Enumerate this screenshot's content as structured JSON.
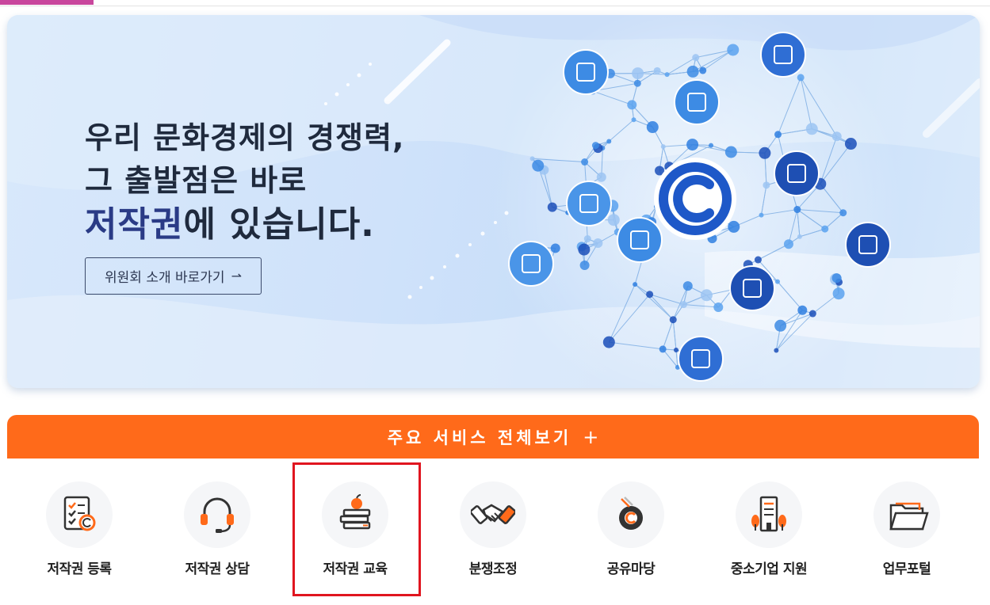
{
  "hero": {
    "line1": "우리 문화경제의 경쟁력,",
    "line2": "그 출발점은 바로",
    "line3_highlight": "저작권",
    "line3_rest": "에 있습니다.",
    "intro_button": "위원회 소개 바로가기",
    "intro_arrow": "⇀"
  },
  "services": {
    "bar_label": "주요 서비스 전체보기",
    "bar_plus": "+",
    "items": [
      {
        "label": "저작권 등록",
        "icon": "registration-checklist-icon"
      },
      {
        "label": "저작권 상담",
        "icon": "headset-icon"
      },
      {
        "label": "저작권 교육",
        "icon": "books-apple-icon"
      },
      {
        "label": "분쟁조정",
        "icon": "handshake-icon"
      },
      {
        "label": "공유마당",
        "icon": "copyright-share-icon"
      },
      {
        "label": "중소기업 지원",
        "icon": "building-icon"
      },
      {
        "label": "업무포털",
        "icon": "folder-icon"
      }
    ]
  },
  "colors": {
    "accent_orange": "#ff6a1a",
    "highlight_red": "#e0151f",
    "hero_blue": "#2a3b86",
    "top_accent": "#c9479d"
  }
}
